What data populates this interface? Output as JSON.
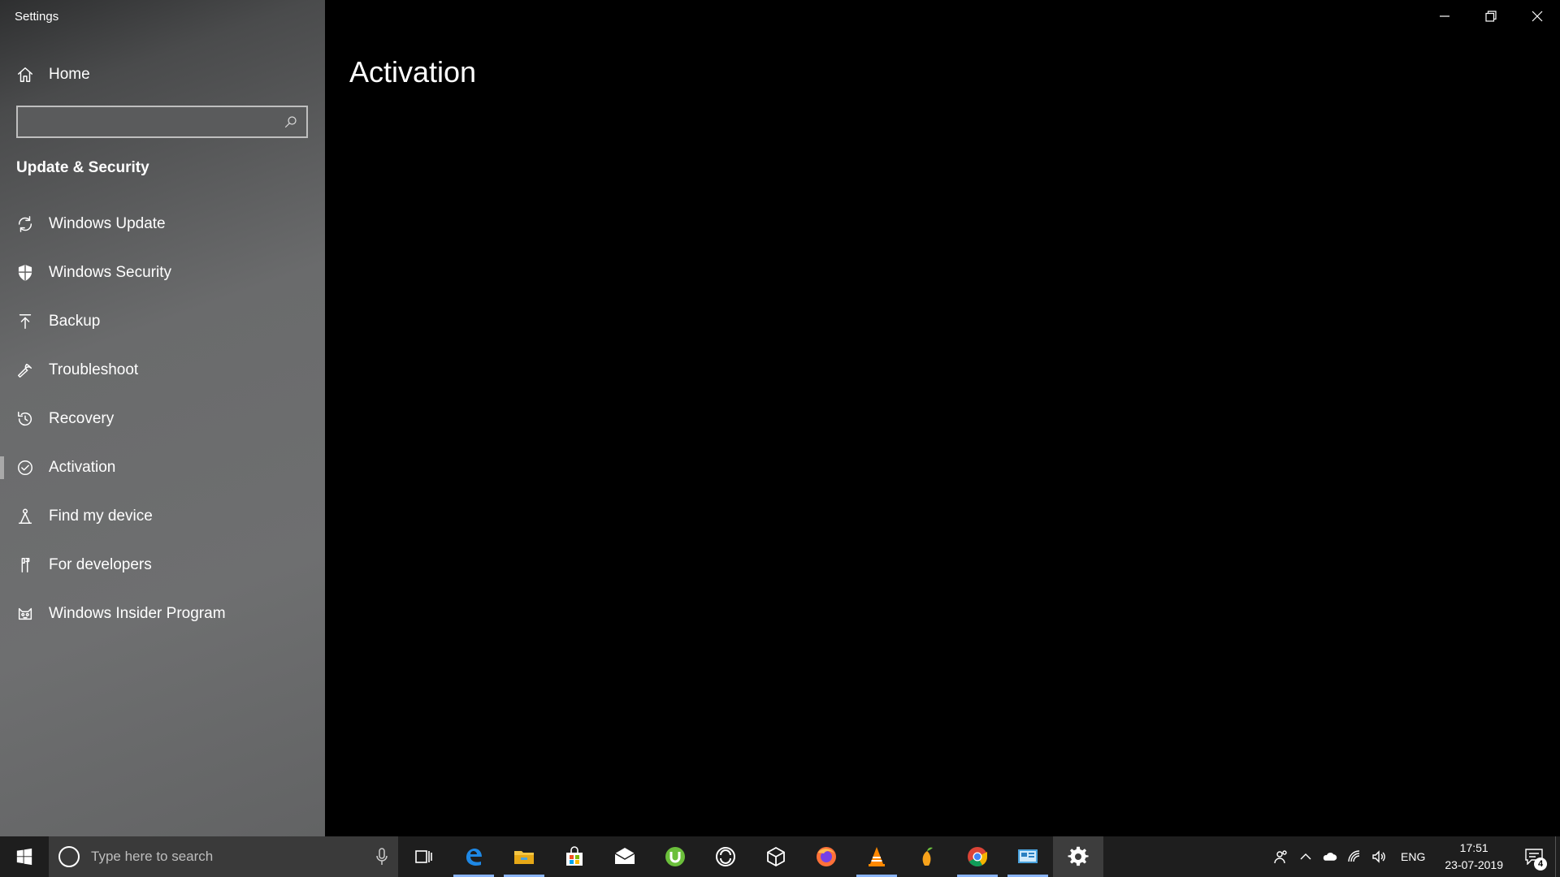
{
  "window": {
    "title": "Settings"
  },
  "sidebar": {
    "home_label": "Home",
    "search_placeholder": "",
    "section_title": "Update & Security",
    "items": [
      {
        "label": "Windows Update",
        "icon": "sync-icon"
      },
      {
        "label": "Windows Security",
        "icon": "shield-icon"
      },
      {
        "label": "Backup",
        "icon": "backup-arrow-icon"
      },
      {
        "label": "Troubleshoot",
        "icon": "wrench-icon"
      },
      {
        "label": "Recovery",
        "icon": "history-icon"
      },
      {
        "label": "Activation",
        "icon": "check-circle-icon",
        "active": true
      },
      {
        "label": "Find my device",
        "icon": "person-locate-icon"
      },
      {
        "label": "For developers",
        "icon": "developer-tools-icon"
      },
      {
        "label": "Windows Insider Program",
        "icon": "insider-cat-icon"
      }
    ]
  },
  "main": {
    "page_title": "Activation"
  },
  "taskbar": {
    "search_placeholder": "Type here to search",
    "apps": [
      {
        "name": "task-view-icon"
      },
      {
        "name": "edge-icon"
      },
      {
        "name": "file-explorer-icon"
      },
      {
        "name": "store-icon"
      },
      {
        "name": "mail-icon"
      },
      {
        "name": "utorrent-icon"
      },
      {
        "name": "sync-app-icon"
      },
      {
        "name": "3d-viewer-icon"
      },
      {
        "name": "firefox-icon"
      },
      {
        "name": "vlc-icon"
      },
      {
        "name": "fl-studio-icon"
      },
      {
        "name": "chrome-icon"
      },
      {
        "name": "control-panel-icon"
      },
      {
        "name": "settings-gear-icon"
      }
    ],
    "tray": {
      "language": "ENG",
      "time": "17:51",
      "date": "23-07-2019",
      "notification_count": "4"
    }
  },
  "colors": {
    "sidebar_bg": "#6a6b6c",
    "main_bg": "#000000",
    "taskbar_bg": "#1e1e1e",
    "accent": "#8ab4f8"
  }
}
